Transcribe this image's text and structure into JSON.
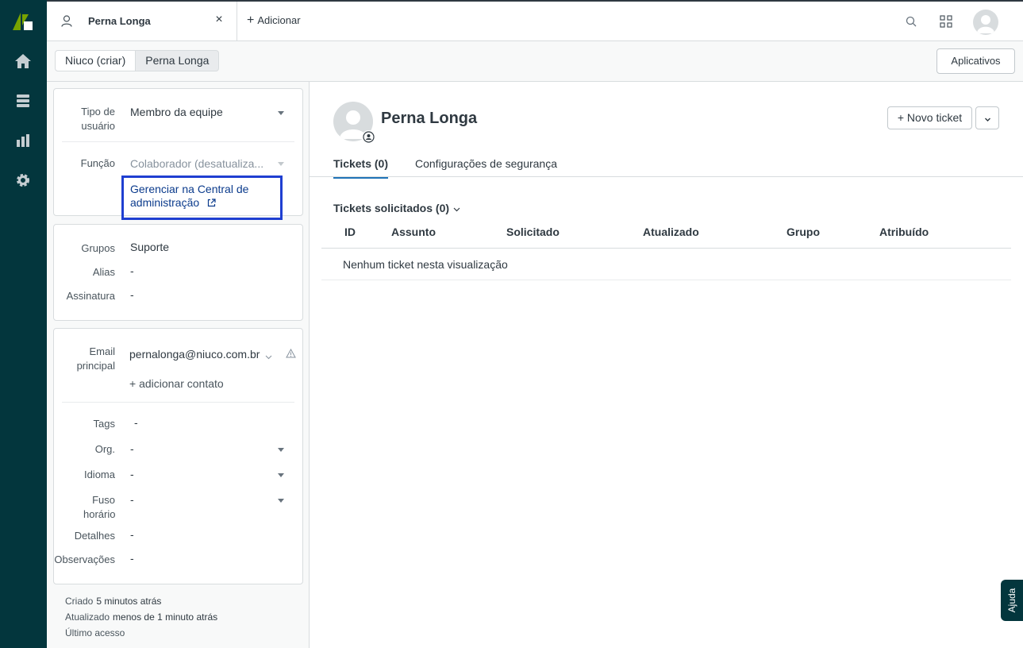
{
  "colors": {
    "rail": "#03363d",
    "accent": "#1f73b7",
    "highlight_box": "#1f3fd1",
    "logo_green": "#78a300"
  },
  "rail": {
    "items": [
      "home-icon",
      "views-icon",
      "reporting-icon",
      "admin-gear-icon"
    ]
  },
  "topbar": {
    "tab_label": "Perna Longa",
    "tab_close": "×",
    "add_plus": "+",
    "add_label": "Adicionar"
  },
  "breadcrumbs": [
    "Niuco (criar)",
    "Perna Longa"
  ],
  "apps_label": "Aplicativos",
  "card1": {
    "user_type_label": "Tipo de usuário",
    "user_type_value": "Membro da equipe",
    "role_label": "Função",
    "role_value": "Colaborador (desatualiza...",
    "manage_link": "Gerenciar na Central de administração"
  },
  "card2": {
    "groups_label": "Grupos",
    "groups_value": "Suporte",
    "alias_label": "Alias",
    "alias_value": "-",
    "signature_label": "Assinatura",
    "signature_value": "-"
  },
  "card3": {
    "email_label": "Email principal",
    "email_value": "pernalonga@niuco.com.br",
    "add_contact": "+ adicionar contato",
    "tags_label": "Tags",
    "tags_value": "-",
    "org_label": "Org.",
    "org_value": "-",
    "language_label": "Idioma",
    "language_value": "-",
    "timezone_label": "Fuso horário",
    "timezone_value": "-",
    "details_label": "Detalhes",
    "details_value": "-",
    "notes_label": "Observações",
    "notes_value": "-"
  },
  "meta": {
    "created_label": "Criado",
    "created_value": "5 minutos atrás",
    "updated_label": "Atualizado",
    "updated_value": "menos de 1 minuto atrás",
    "last_access_label": "Último acesso"
  },
  "profile": {
    "name": "Perna Longa",
    "new_ticket": "+ Novo ticket"
  },
  "tabs": [
    "Tickets (0)",
    "Configurações de segurança"
  ],
  "tickets": {
    "section_title": "Tickets solicitados (0)",
    "columns": [
      "ID",
      "Assunto",
      "Solicitado",
      "Atualizado",
      "Grupo",
      "Atribuído"
    ],
    "empty_text": "Nenhum ticket nesta visualização"
  },
  "help_label": "Ajuda"
}
